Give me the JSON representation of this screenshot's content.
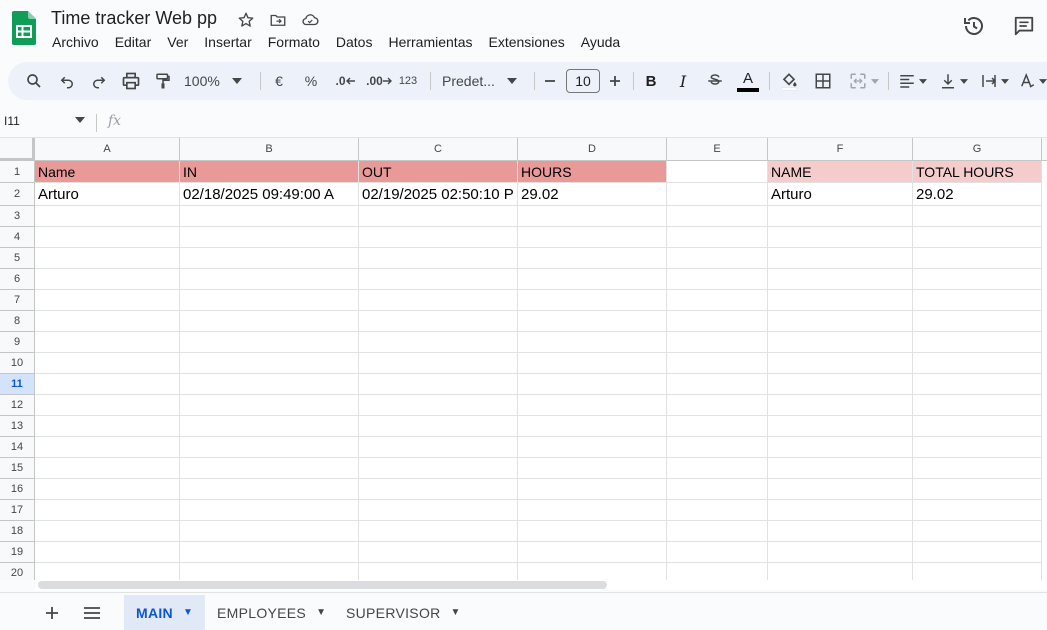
{
  "document": {
    "title": "Time tracker Web pp"
  },
  "menu": [
    "Archivo",
    "Editar",
    "Ver",
    "Insertar",
    "Formato",
    "Datos",
    "Herramientas",
    "Extensiones",
    "Ayuda"
  ],
  "toolbar": {
    "zoom": "100%",
    "currency": "€",
    "percent": "%",
    "dec_decrease": ".0",
    "dec_increase": ".00",
    "more_formats": "123",
    "font": "Predet...",
    "font_size": "10",
    "text_color_letter": "A",
    "text_color": "#000000",
    "accent": "#0b57d0"
  },
  "formula_bar": {
    "name_box": "I11",
    "fx": "fx",
    "value": ""
  },
  "grid": {
    "columns": [
      "A",
      "B",
      "C",
      "D",
      "E",
      "F",
      "G"
    ],
    "rows": [
      "1",
      "2",
      "3",
      "4",
      "5",
      "6",
      "7",
      "8",
      "9",
      "10",
      "11",
      "12",
      "13",
      "14",
      "15",
      "16",
      "17",
      "18",
      "19",
      "20"
    ],
    "active_row": "11",
    "header_color_main": "#ea9999",
    "header_color_summary": "#f4cccc",
    "cells": {
      "A1": "Name",
      "B1": "IN",
      "C1": "OUT",
      "D1": "HOURS",
      "F1": "NAME",
      "G1": "TOTAL HOURS",
      "A2": "Arturo",
      "B2": "02/18/2025 09:49:00 A",
      "C2": "02/19/2025 02:50:10 P",
      "D2": "29.02",
      "F2": "Arturo",
      "G2": "29.02"
    }
  },
  "sheets": [
    {
      "name": "MAIN",
      "active": true
    },
    {
      "name": "EMPLOYEES",
      "active": false
    },
    {
      "name": "SUPERVISOR",
      "active": false
    }
  ]
}
